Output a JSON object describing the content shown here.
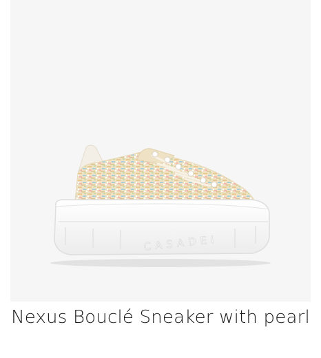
{
  "product": {
    "name": "Nexus Bouclé Sneaker with pearl",
    "sole_brand_text": "CASADEI",
    "image_icon": "sneaker-image",
    "colors": {
      "background": "#f6f6f6",
      "sole": "#ffffff",
      "boucle_base": "#efe2c4"
    }
  }
}
